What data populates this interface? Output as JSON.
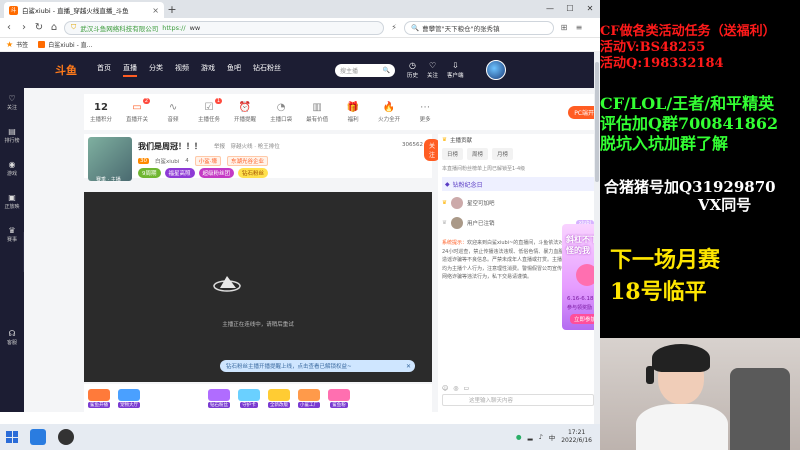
{
  "browser": {
    "tab_title": "白鲨xiubi - 直播_穿越火线直播_斗鱼",
    "address": {
      "org": "武汉斗鱼网络科技有限公司",
      "protocol": "https://",
      "host": "ww"
    },
    "search_text": "曹攀管\"天下粮仓\"的张秀镇",
    "bookmarks": [
      {
        "label": "书签"
      },
      {
        "label": "白鲨xiubi - 直..."
      }
    ]
  },
  "douyu": {
    "logo": "斗鱼",
    "nav": [
      "首页",
      "直播",
      "分类",
      "视频",
      "游戏",
      "鱼吧",
      "钻石粉丝"
    ],
    "search_placeholder": "搜主播",
    "header_icons": [
      {
        "icon": "history-icon",
        "label": "历史"
      },
      {
        "icon": "follow-icon",
        "label": "关注"
      },
      {
        "icon": "download-icon",
        "label": "客户端"
      }
    ],
    "rail": [
      {
        "icon": "heart-icon",
        "label": "关注"
      },
      {
        "icon": "rank-icon",
        "label": "排行榜"
      },
      {
        "icon": "game-icon",
        "label": "游戏"
      },
      {
        "icon": "tv-icon",
        "label": "正放映"
      },
      {
        "icon": "crown-icon",
        "label": "赛事"
      },
      {
        "icon": "support-icon",
        "label": "客服"
      }
    ]
  },
  "toolbar": {
    "items": [
      {
        "num": "12",
        "label": "主播积分",
        "badge": ""
      },
      {
        "label": "直播开关",
        "badge": "2"
      },
      {
        "label": "音频",
        "badge": ""
      },
      {
        "label": "主播任务",
        "badge": "1"
      },
      {
        "label": "开播提醒",
        "badge": ""
      },
      {
        "label": "主播口袋",
        "badge": ""
      },
      {
        "label": "最有价值",
        "badge": ""
      },
      {
        "label": "福利",
        "badge": ""
      },
      {
        "label": "火力全开",
        "badge": ""
      },
      {
        "label": "更多",
        "badge": ""
      }
    ],
    "pc_button": "PC端开播"
  },
  "room": {
    "title": "我们是周冠！！！",
    "tag": "举报",
    "tags_line": "穿越火线 · 枪王排位",
    "level": "30",
    "streamer": "白鲨xiubi",
    "fans": "4",
    "pills2": [
      "小鲨·壕",
      "东湖光谷企业"
    ],
    "pills3": [
      "9周期",
      "福星高照",
      "超级粉丝团",
      "钻石粉丝"
    ],
    "hot": "306562",
    "follow": "关注",
    "avatar_label": "赛季 · 主播"
  },
  "video": {
    "message": "主播正在连线中，请稍后重试",
    "banner": "钻石粉丝主播开播提醒上线，点击查看已解锁权益~"
  },
  "gifts": [
    "鲨鱼开播",
    "宠物大厅",
    "钻石粉丝",
    "守护卡",
    "全新改版",
    "小鲨工厂",
    "鲨鱼粉"
  ],
  "panel": {
    "head": "主播贡献",
    "tabs": [
      "日榜",
      "周榜",
      "月榜"
    ],
    "note": "本直播间粉丝榜单上周已解锁至1-4级",
    "section": "钻粉纪念日",
    "rows": [
      {
        "name": "星空可加吧",
        "chip": ""
      },
      {
        "name": "用户已注销",
        "chip": "xiubi"
      }
    ],
    "system_label": "系统提示：",
    "system_text": "欢迎来到白鲨xiubi~的直播间，斗鱼依法对直播内容进行24小时巡查，禁止传播违法违规、低俗色情、暴力血腥、吸烟酗酒、造谣诈骗等不良信息。严禁未成年人直播或打赏。主播以下的行为，均为主播个人行为，注意理性消费。警惕假冒公司宣传的博彩平台或网络诈骗等违法行为，私下交易请谨慎。",
    "input_placeholder": "这里输入聊天内容"
  },
  "promo": {
    "title": "斜杠不下 奇怪的我",
    "dates": "6.16-6.18",
    "sub": "参与领奖励",
    "button": "立即参加"
  },
  "taskbar": {
    "time": "17:21",
    "date": "2022/6/16",
    "lang": "中"
  },
  "overlay": {
    "red_lines": [
      "CF做各类活动任务（送福利）",
      "活动V:BS48255",
      "活动Q:198332184"
    ],
    "green_lines": [
      "CF/LOL/王者/和平精英",
      "评估加Q群700841862",
      "脱坑入坑加群了解"
    ],
    "white_lines": [
      "合猪猪号加Q31929870",
      "VX同号"
    ],
    "yellow_lines": [
      "下一场月赛",
      "18号临平"
    ]
  }
}
